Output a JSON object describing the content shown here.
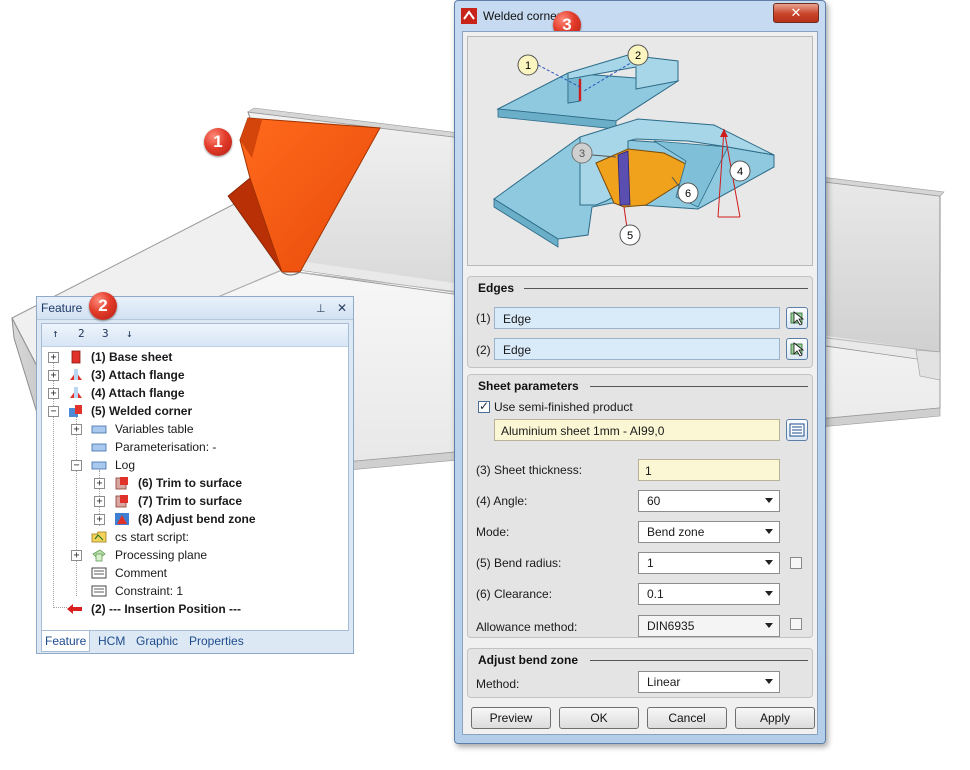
{
  "markers": [
    "1",
    "2",
    "3"
  ],
  "feature_panel": {
    "title": "Feature",
    "controls": {
      "pin": "⊥",
      "close": "✕"
    },
    "toolbar": [
      "↑",
      "2",
      "3",
      "↓"
    ],
    "tree": [
      {
        "label": "(1) Base sheet",
        "bold": true,
        "icon": "base-sheet-icon"
      },
      {
        "label": "(3) Attach flange",
        "bold": true,
        "icon": "attach-flange-icon"
      },
      {
        "label": "(4) Attach flange",
        "bold": true,
        "icon": "attach-flange-icon"
      },
      {
        "label": "(5) Welded corner",
        "bold": true,
        "icon": "welded-corner-icon"
      },
      {
        "label": "Variables table",
        "bold": false,
        "icon": "variables-table-icon"
      },
      {
        "label": "Parameterisation: -",
        "bold": false,
        "icon": "parameterisation-icon"
      },
      {
        "label": "Log",
        "bold": false,
        "icon": "log-icon"
      },
      {
        "label": "(6) Trim to surface",
        "bold": true,
        "icon": "trim-surface-icon"
      },
      {
        "label": "(7) Trim to surface",
        "bold": true,
        "icon": "trim-surface-icon"
      },
      {
        "label": "(8) Adjust bend zone",
        "bold": true,
        "icon": "adjust-bend-zone-icon"
      },
      {
        "label": "cs start script:",
        "bold": false,
        "icon": "script-folder-icon"
      },
      {
        "label": "Processing plane",
        "bold": false,
        "icon": "processing-plane-icon"
      },
      {
        "label": "Comment",
        "bold": false,
        "icon": "comment-icon"
      },
      {
        "label": "Constraint: 1",
        "bold": false,
        "icon": "constraint-icon"
      },
      {
        "label": "(2) --- Insertion Position ---",
        "bold": true,
        "icon": "insertion-arrow-icon"
      }
    ],
    "tabs": [
      "Feature",
      "HCM",
      "Graphic",
      "Properties"
    ]
  },
  "dialog": {
    "title": "Welded corner",
    "close_label": "✕",
    "preview_callouts": [
      "1",
      "2",
      "3",
      "4",
      "5",
      "6"
    ],
    "edges": {
      "title": "Edges",
      "edge1_label": "(1)",
      "edge1_value": "Edge",
      "edge2_label": "(2)",
      "edge2_value": "Edge"
    },
    "sheet": {
      "title": "Sheet parameters",
      "use_semi_label": "Use semi-finished product",
      "use_semi_checked": true,
      "semi_value": "Aluminium sheet 1mm - AI99,0",
      "thickness_label": "(3) Sheet thickness:",
      "thickness_value": "1",
      "angle_label": "(4) Angle:",
      "angle_value": "60",
      "mode_label": "Mode:",
      "mode_value": "Bend zone",
      "radius_label": "(5) Bend radius:",
      "radius_value": "1",
      "clearance_label": "(6) Clearance:",
      "clearance_value": "0.1",
      "allowance_label": "Allowance method:",
      "allowance_value": "DIN6935"
    },
    "adjust": {
      "title": "Adjust bend zone",
      "method_label": "Method:",
      "method_value": "Linear"
    },
    "buttons": {
      "preview": "Preview",
      "ok": "OK",
      "cancel": "Cancel",
      "apply": "Apply"
    }
  }
}
